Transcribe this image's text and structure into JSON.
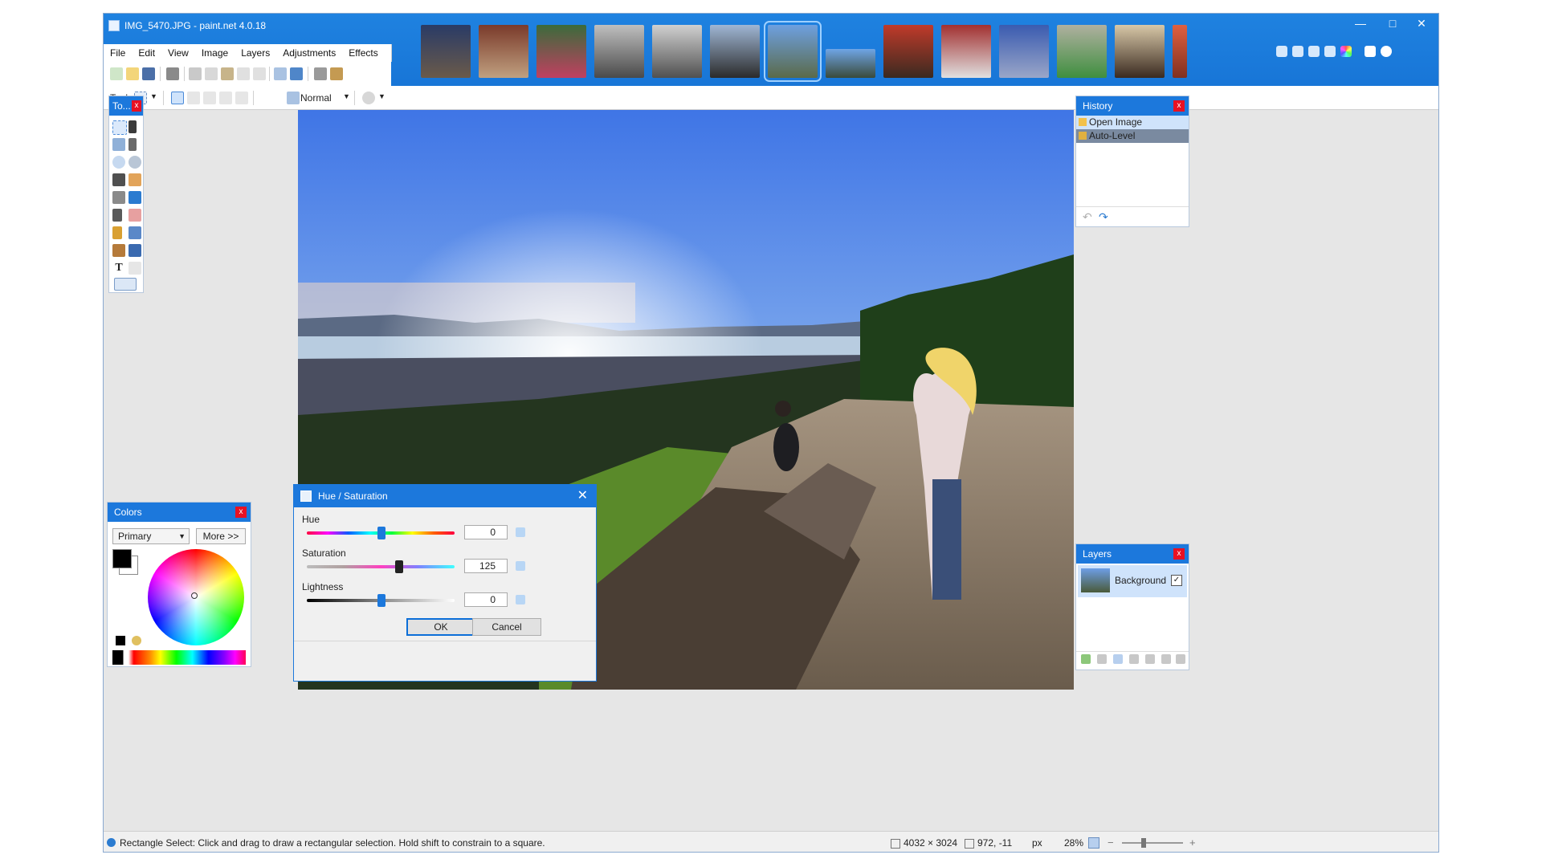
{
  "window": {
    "title": "IMG_5470.JPG - paint.net 4.0.18"
  },
  "menu": [
    "File",
    "Edit",
    "View",
    "Image",
    "Layers",
    "Adjustments",
    "Effects"
  ],
  "toolbar": {
    "tool_label": "Tool:",
    "blend_mode": "Normal"
  },
  "tools_panel": {
    "title": "To..."
  },
  "history": {
    "title": "History",
    "items": [
      {
        "label": "Open Image",
        "icon": "open-image-icon"
      },
      {
        "label": "Auto-Level",
        "icon": "auto-level-icon"
      }
    ]
  },
  "colors": {
    "title": "Colors",
    "select_value": "Primary",
    "more_label": "More >>",
    "primary_color": "#000000",
    "secondary_color": "#ffffff"
  },
  "layers": {
    "title": "Layers",
    "items": [
      {
        "name": "Background",
        "visible": true
      }
    ]
  },
  "dialog": {
    "title": "Hue / Saturation",
    "hue_label": "Hue",
    "hue_value": "0",
    "saturation_label": "Saturation",
    "saturation_value": "125",
    "lightness_label": "Lightness",
    "lightness_value": "0",
    "ok_label": "OK",
    "cancel_label": "Cancel"
  },
  "status": {
    "hint": "Rectangle Select: Click and drag to draw a rectangular selection. Hold shift to constrain to a square.",
    "image_size": "4032 × 3024",
    "cursor_pos": "972, -11",
    "units": "px",
    "zoom": "28%"
  },
  "accent_color": "#1c78dc"
}
